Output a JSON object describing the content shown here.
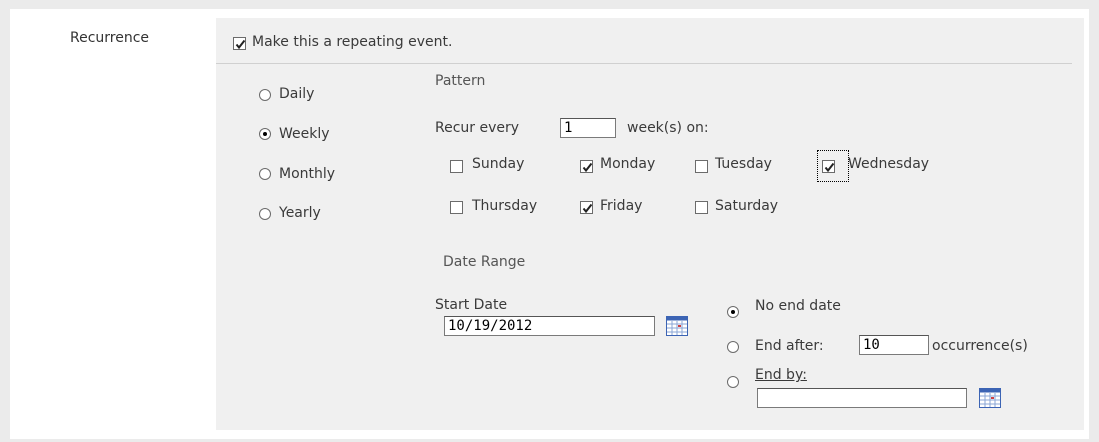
{
  "recurrence": {
    "label": "Recurrence"
  },
  "repeat": {
    "label": "Make this a repeating event.",
    "checked": true
  },
  "frequency": {
    "options": [
      {
        "label": "Daily",
        "selected": false
      },
      {
        "label": "Weekly",
        "selected": true
      },
      {
        "label": "Monthly",
        "selected": false
      },
      {
        "label": "Yearly",
        "selected": false
      }
    ]
  },
  "pattern": {
    "heading": "Pattern",
    "recur_prefix": "Recur every",
    "interval_value": "1",
    "recur_suffix": "week(s) on:",
    "days": [
      {
        "label": "Sunday",
        "checked": false
      },
      {
        "label": "Monday",
        "checked": true
      },
      {
        "label": "Tuesday",
        "checked": false
      },
      {
        "label": "Wednesday",
        "checked": true
      },
      {
        "label": "Thursday",
        "checked": false
      },
      {
        "label": "Friday",
        "checked": true
      },
      {
        "label": "Saturday",
        "checked": false
      }
    ]
  },
  "date_range": {
    "heading": "Date Range",
    "start_label": "Start Date",
    "start_value": "10/19/2012",
    "no_end_label": "No end date",
    "end_after_label": "End after:",
    "end_after_value": "10",
    "occurrences_label": "occurrence(s)",
    "end_by_label": "End by:",
    "end_by_value": "",
    "selected": "No end date"
  },
  "colors": {
    "panel": "#f0f0f0",
    "outer": "#ebebeb",
    "calendar_blue": "#3c64b4"
  },
  "icons": {
    "calendar": "calendar-icon"
  }
}
